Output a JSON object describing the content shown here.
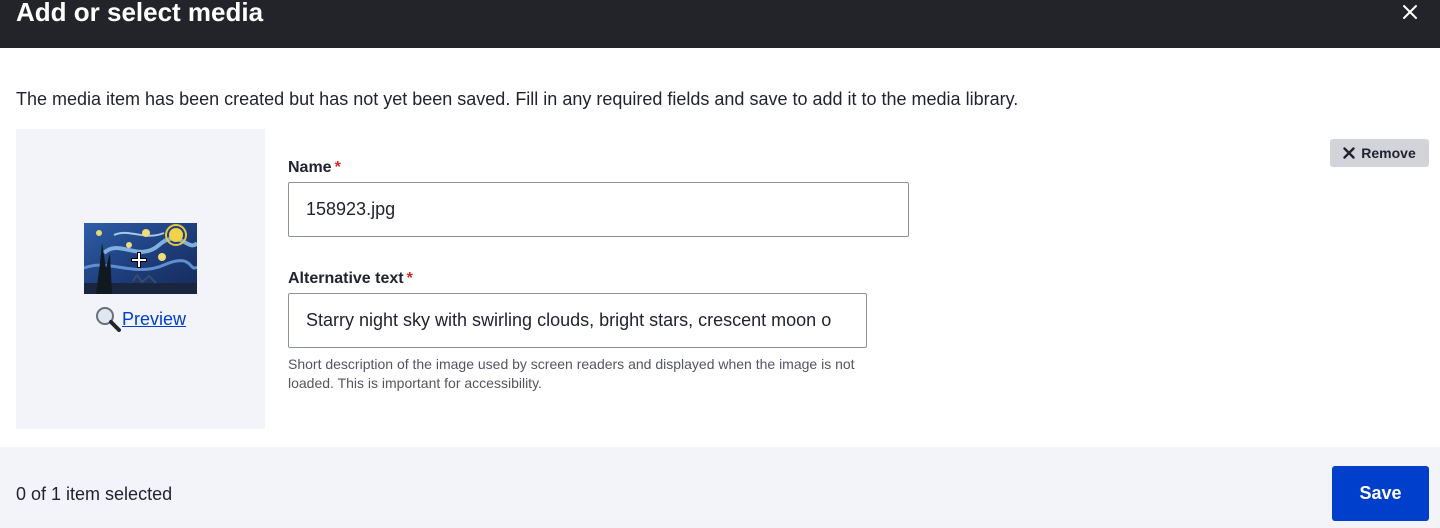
{
  "dialog": {
    "title": "Add or select media",
    "close_icon": "close-icon"
  },
  "message": "The media item has been created but has not yet been saved. Fill in any required fields and save to add it to the media library.",
  "media_item": {
    "thumbnail_icon": "image-thumbnail",
    "preview_label": "Preview",
    "preview_icon": "magnifier-icon",
    "remove_label": "Remove",
    "remove_icon": "x-icon",
    "name": {
      "label": "Name",
      "required_marker": "*",
      "value": "158923.jpg"
    },
    "alt_text": {
      "label": "Alternative text",
      "required_marker": "*",
      "value": "Starry night sky with swirling clouds, bright stars, crescent moon o",
      "help": "Short description of the image used by screen readers and displayed when the image is not loaded. This is important for accessibility."
    }
  },
  "footer": {
    "selected_count": "0 of 1 item selected",
    "save_label": "Save"
  },
  "colors": {
    "titlebar": "#232429",
    "primary": "#003ecc",
    "required": "#dc2323",
    "panel_bg": "#f3f4f9"
  }
}
